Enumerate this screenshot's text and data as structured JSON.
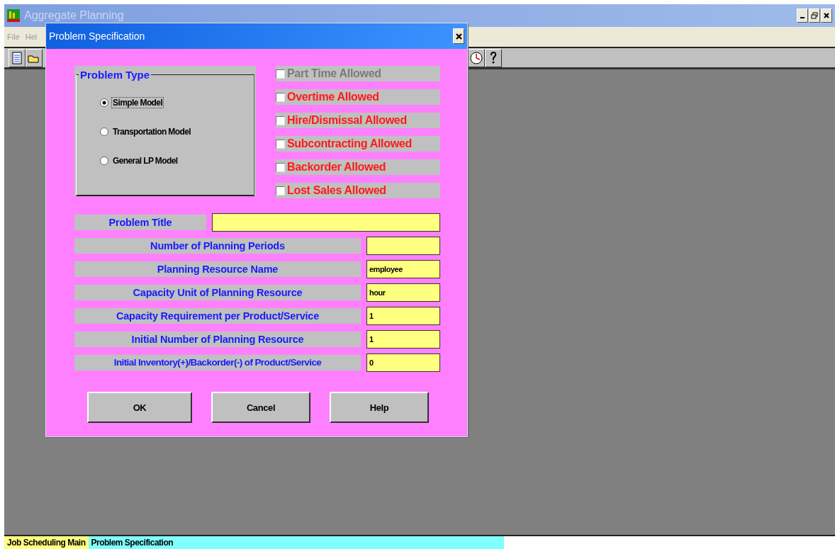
{
  "app": {
    "title": "Aggregate Planning",
    "menu": [
      "File",
      "Hel"
    ]
  },
  "dialog": {
    "title": "Problem Specification",
    "problem_type": {
      "label": "Problem Type",
      "options": [
        {
          "label": "Simple Model",
          "selected": true
        },
        {
          "label": "Transportation Model",
          "selected": false
        },
        {
          "label": "General LP Model",
          "selected": false
        }
      ]
    },
    "options": [
      {
        "label": "Part Time Allowed",
        "checked": false,
        "disabled": true
      },
      {
        "label": "Overtime Allowed",
        "checked": false,
        "disabled": false
      },
      {
        "label": "Hire/Dismissal Allowed",
        "checked": false,
        "disabled": false
      },
      {
        "label": "Subcontracting Allowed",
        "checked": false,
        "disabled": false
      },
      {
        "label": "Backorder Allowed",
        "checked": false,
        "disabled": false
      },
      {
        "label": "Lost Sales Allowed",
        "checked": false,
        "disabled": false
      }
    ],
    "title_field": {
      "label": "Problem Title"
    },
    "fields": [
      {
        "label": "Number of Planning Periods"
      },
      {
        "label": "Planning Resource Name",
        "value": "employee"
      },
      {
        "label": "Capacity Unit of Planning Resource",
        "value": "hour"
      },
      {
        "label": "Capacity Requirement per Product/Service",
        "value": "1"
      },
      {
        "label": "Initial Number of Planning Resource",
        "value": "1"
      },
      {
        "label": "Initial Inventory(+)/Backorder(-) of Product/Service",
        "value": "0"
      }
    ],
    "buttons": [
      "OK",
      "Cancel",
      "Help"
    ]
  },
  "status_bar": [
    {
      "label": "Job Scheduling Main",
      "selected": false
    },
    {
      "label": "Problem Specification",
      "selected": true
    }
  ]
}
